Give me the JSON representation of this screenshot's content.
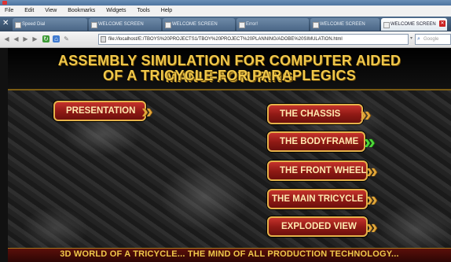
{
  "menu": {
    "file": "File",
    "edit": "Edit",
    "view": "View",
    "bookmarks": "Bookmarks",
    "widgets": "Widgets",
    "tools": "Tools",
    "help": "Help"
  },
  "tabs": {
    "speed_dial": "Speed Dial",
    "t1": "WELCOME SCREEN",
    "t2": "WELCOME SCREEN",
    "t3": "Error!",
    "t4": "WELCOME SCREEN",
    "t5": "WELCOME SCREEN"
  },
  "address": {
    "url": "file://localhost/E:/TBOYS%20PROJECTS1/TBOY%20PROJECT%20PLANNING/ADOBE%20SIMULATION.html"
  },
  "search": {
    "placeholder": "Google"
  },
  "page": {
    "title_line1": "ASSEMBLY SIMULATION FOR COMPUTER AIDED MANUFACTURING",
    "title_line2": "OF A TRICYCLE FOR  PARAPLEGICS",
    "buttons": {
      "presentation": "PRESENTATION",
      "chassis": "THE CHASSIS",
      "bodyframe": "THE BODYFRAME",
      "front_wheel": "THE FRONT WHEEL",
      "main_tricycle": "THE MAIN TRICYCLE",
      "exploded_view": "EXPLODED VIEW"
    },
    "footer": "3D WORLD OF A TRICYCLE...  THE MIND OF ALL PRODUCTION TECHNOLOGY..."
  }
}
